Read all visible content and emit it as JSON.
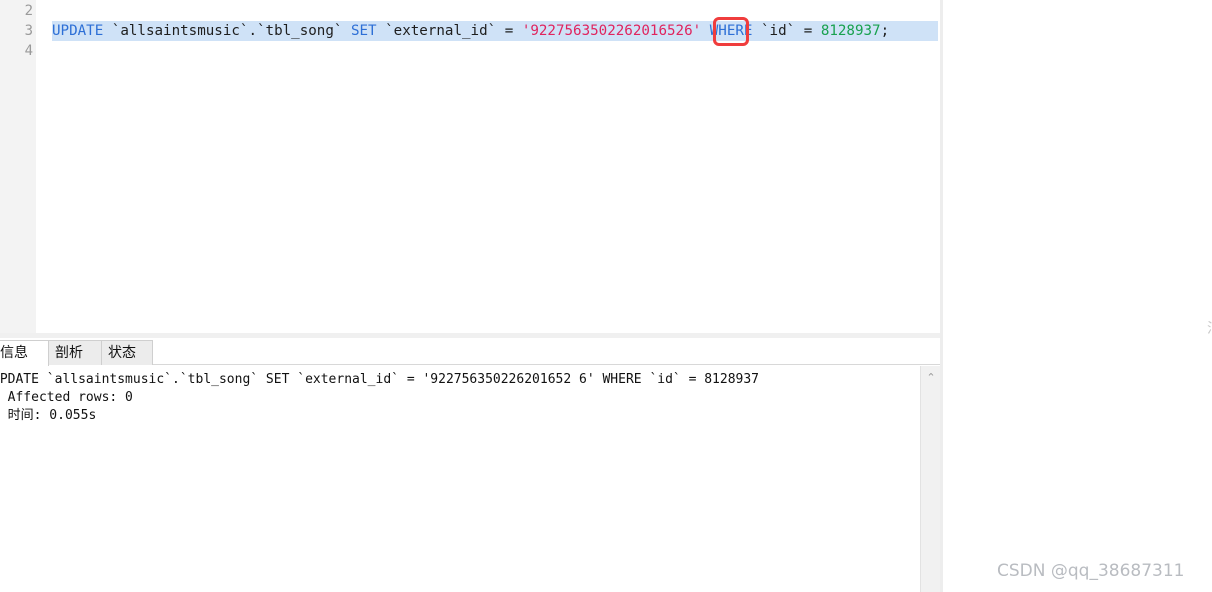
{
  "editor": {
    "line_numbers": [
      "2",
      "3",
      "4"
    ],
    "sql_line": {
      "kw_update": "UPDATE",
      "table": " `allsaintsmusic`.`tbl_song` ",
      "kw_set": "SET",
      "column": " `external_id` = ",
      "string_value": "'922756350226201652",
      "string_value_tail": "6'",
      "kw_where_pre": " ",
      "kw_where": "WHERE",
      "id_part": " `id` = ",
      "id_value": "8128937",
      "terminator": ";"
    }
  },
  "results": {
    "tabs": [
      "信息",
      "剖析",
      "状态"
    ],
    "active_tab": "信息",
    "lines": [
      "UPDATE `allsaintsmusic`.`tbl_song` SET `external_id` = '922756350226201652 6' WHERE `id` = 8128937",
      "> Affected rows: 0",
      "> 时间: 0.055s"
    ]
  },
  "icons": {
    "scroll_up": "chevron-up-icon"
  },
  "colors": {
    "keyword": "#2d6fd6",
    "string": "#e0245e",
    "number": "#19a14f",
    "selection": "#cfe2f7",
    "highlight_box": "#f03d3d"
  },
  "watermark": "CSDN @qq_38687311",
  "edge_text": "油"
}
